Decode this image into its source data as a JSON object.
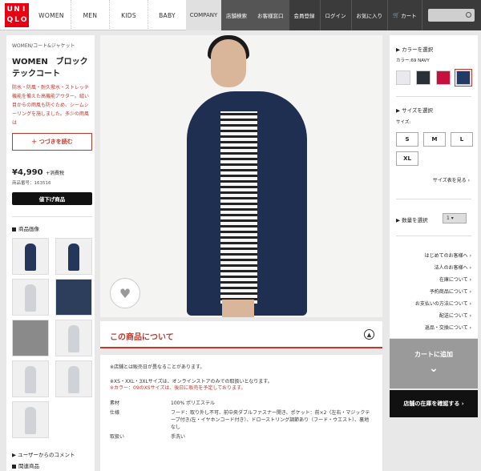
{
  "header": {
    "logo_chars": [
      "U",
      "N",
      "I",
      "Q",
      "L",
      "O"
    ],
    "nav": [
      "WOMEN",
      "MEN",
      "KIDS",
      "BABY"
    ],
    "company": "COMPANY",
    "dark_items": [
      "店舗検索",
      "お客様窓口",
      "会員登録",
      "ログイン",
      "お気に入り",
      "カート"
    ],
    "brand_color": "#e60012"
  },
  "product": {
    "breadcrumb": "WOMEN/コート&ジャケット",
    "title": "WOMEN　ブロックテックコート",
    "description": "防水・防風・耐久撥水・ストレッチ機能を備えた高機能アウター。縫い目からの雨風も防ぐため、シームシーリングを施しました。多少の雨風は",
    "read_more": "つづきを読む",
    "price": "¥4,990",
    "tax": "+消費税",
    "code": "商品番号：163516",
    "price_down": "値下げ商品",
    "images_label": "商品画像",
    "user_comments": "ユーザーからのコメント",
    "related": "関連商品"
  },
  "about": {
    "title": "この商品について",
    "note1": "※店舗とは販売日が異なることがあります。",
    "note2": "※XS・XXL・3XLサイズは、オンラインストアのみでの取扱いとなります。",
    "note3": "※カラー：09のXSサイズは、後日に販売を予定しております。",
    "specs": [
      {
        "k": "素材",
        "v": "100% ポリエステル"
      },
      {
        "k": "仕様",
        "v": "フード：取り外し不可、前中央ダブルファスナー開き、ポケット：前×2（左右・マジックテープ付き/左・イヤホンコード付き）、ドローストリング調節あり（フード・ウエスト）、裏地なし"
      },
      {
        "k": "取扱い",
        "v": "手洗い"
      }
    ]
  },
  "options": {
    "color_label": "カラーを選択",
    "color_value": "カラー:69 NAVY",
    "colors": [
      "#e9e9ee",
      "#2b2f36",
      "#c8103e",
      "#233a66"
    ],
    "size_label": "サイズを選択",
    "size_sub": "サイズ:",
    "sizes": [
      "S",
      "M",
      "L",
      "XL"
    ],
    "size_guide": "サイズ表を見る",
    "qty_label": "数量を選択",
    "qty_value": "1",
    "links": [
      "はじめてのお客様へ",
      "法人のお客様へ",
      "在庫について",
      "予約商品について",
      "お支払いの方法について",
      "配送について",
      "返品・交換について"
    ],
    "add_to_cart": "カートに追加",
    "store_stock": "店舗の在庫を確認する"
  }
}
